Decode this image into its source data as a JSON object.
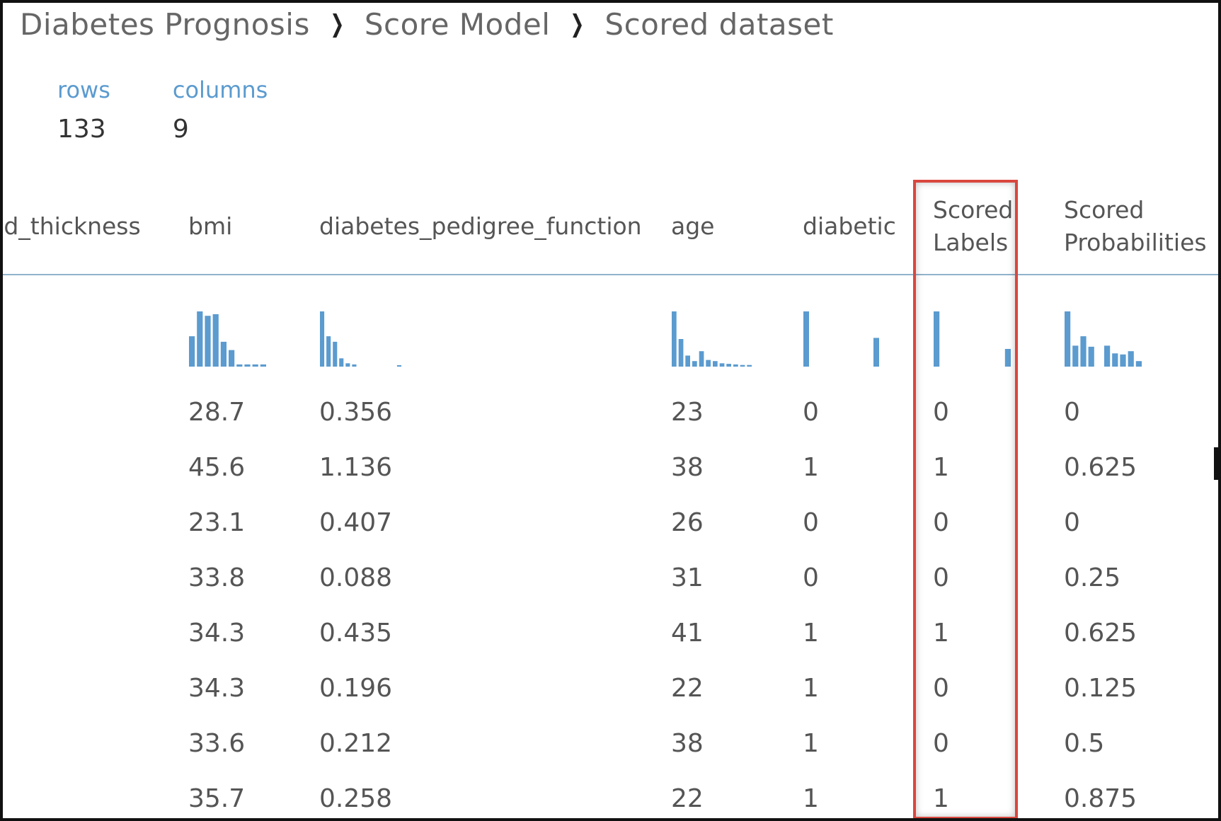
{
  "breadcrumb": {
    "items": [
      "Diabetes Prognosis",
      "Score Model",
      "Scored dataset"
    ]
  },
  "stats": {
    "rows_label": "rows",
    "rows_value": "133",
    "columns_label": "columns",
    "columns_value": "9"
  },
  "table": {
    "columns": [
      {
        "key": "skin",
        "header": "old_thickness",
        "header2": ""
      },
      {
        "key": "bmi",
        "header": "bmi",
        "header2": ""
      },
      {
        "key": "dpf",
        "header": "diabetes_pedigree_function",
        "header2": ""
      },
      {
        "key": "age",
        "header": "age",
        "header2": ""
      },
      {
        "key": "diabetic",
        "header": "diabetic",
        "header2": ""
      },
      {
        "key": "scored_labels",
        "header": "Scored",
        "header2": "Labels"
      },
      {
        "key": "scored_prob",
        "header": "Scored",
        "header2": "Probabilities"
      }
    ],
    "rows": [
      {
        "bmi": "28.7",
        "dpf": "0.356",
        "age": "23",
        "diabetic": "0",
        "scored_labels": "0",
        "scored_prob": "0"
      },
      {
        "bmi": "45.6",
        "dpf": "1.136",
        "age": "38",
        "diabetic": "1",
        "scored_labels": "1",
        "scored_prob": "0.625"
      },
      {
        "bmi": "23.1",
        "dpf": "0.407",
        "age": "26",
        "diabetic": "0",
        "scored_labels": "0",
        "scored_prob": "0"
      },
      {
        "bmi": "33.8",
        "dpf": "0.088",
        "age": "31",
        "diabetic": "0",
        "scored_labels": "0",
        "scored_prob": "0.25"
      },
      {
        "bmi": "34.3",
        "dpf": "0.435",
        "age": "41",
        "diabetic": "1",
        "scored_labels": "1",
        "scored_prob": "0.625"
      },
      {
        "bmi": "34.3",
        "dpf": "0.196",
        "age": "22",
        "diabetic": "1",
        "scored_labels": "0",
        "scored_prob": "0.125"
      },
      {
        "bmi": "33.6",
        "dpf": "0.212",
        "age": "38",
        "diabetic": "1",
        "scored_labels": "0",
        "scored_prob": "0.5"
      },
      {
        "bmi": "35.7",
        "dpf": "0.258",
        "age": "22",
        "diabetic": "1",
        "scored_labels": "1",
        "scored_prob": "0.875"
      }
    ],
    "histograms": {
      "bmi": [
        0.55,
        1.0,
        0.92,
        0.95,
        0.45,
        0.3,
        0.04,
        0.04,
        0.04,
        0.04
      ],
      "dpf": [
        1.0,
        0.55,
        0.45,
        0.15,
        0.06,
        0.04,
        0.0,
        0.0,
        0.0,
        0.0,
        0.0,
        0.0,
        0.02
      ],
      "age": [
        1.0,
        0.5,
        0.2,
        0.1,
        0.28,
        0.12,
        0.1,
        0.06,
        0.05,
        0.04,
        0.03,
        0.03
      ],
      "diabetic": [
        1.0,
        0.0,
        0.0,
        0.0,
        0.0,
        0.0,
        0.0,
        0.0,
        0.0,
        0.52
      ],
      "scored_labels": [
        1.0,
        0.0,
        0.0,
        0.0,
        0.0,
        0.0,
        0.0,
        0.0,
        0.0,
        0.32
      ],
      "scored_prob": [
        1.0,
        0.38,
        0.55,
        0.36,
        0.0,
        0.38,
        0.24,
        0.22,
        0.28,
        0.1
      ]
    }
  },
  "accent_color": "#5b9bcf",
  "highlight_color": "#d9473e"
}
